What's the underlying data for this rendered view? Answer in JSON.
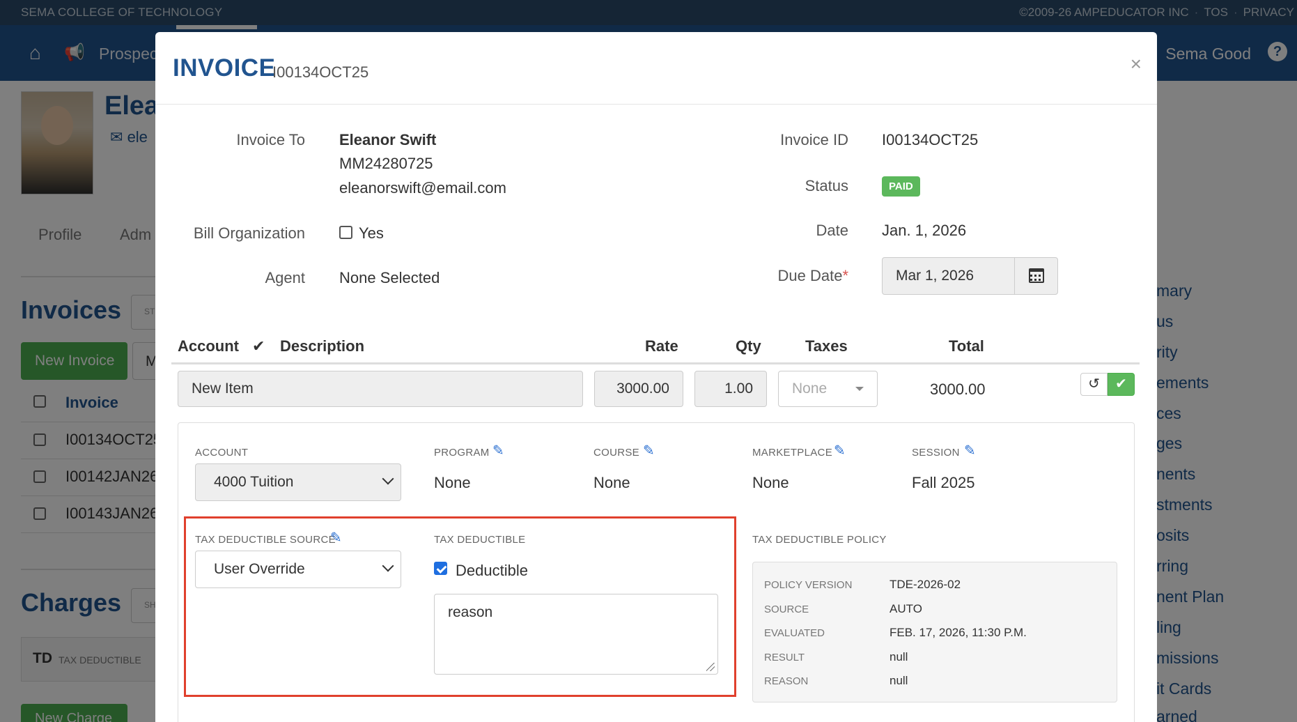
{
  "topbar": {
    "org": "SEMA COLLEGE OF TECHNOLOGY",
    "copyright": "©2009-26 AMPEDUCATOR INC",
    "sep": "·",
    "tos": "TOS",
    "privacy": "PRIVACY"
  },
  "navbar": {
    "home_icon": "⌂",
    "announce_icon": "📢",
    "nav_label": "Prospec",
    "user": "Sema Good",
    "help": "?"
  },
  "background": {
    "profile_name": "Elea",
    "profile_email": "ele",
    "email_icon": "✉",
    "tabs": [
      "Profile",
      "Adm"
    ],
    "invoices_heading": "Invoices",
    "search_placeholder": "ST",
    "new_invoice_label": "New Invoice",
    "m_button": "M",
    "invoice_column": "Invoice",
    "invoice_rows": [
      "I00134OCT25",
      "I00142JAN26",
      "I00143JAN26"
    ],
    "charges_heading": "Charges",
    "charges_search": "SH",
    "td_code": "TD",
    "td_label": "TAX DEDUCTIBLE",
    "new_charge_label": "New Charge",
    "right_nav": [
      "mary",
      "us",
      "rity",
      "ements",
      "ces",
      "ges",
      "nents",
      "stments",
      "osits",
      "rring",
      "nent Plan",
      "ling",
      "missions",
      "it Cards",
      "arned"
    ]
  },
  "modal": {
    "title": "INVOICE",
    "subtitle": "I00134OCT25",
    "close": "×",
    "invoice_to_label": "Invoice To",
    "invoice_to_name": "Eleanor Swift",
    "invoice_to_id": "MM24280725",
    "invoice_to_email": "eleanorswift@email.com",
    "bill_org_label": "Bill Organization",
    "bill_org_option": "Yes",
    "bill_org_checked": false,
    "agent_label": "Agent",
    "agent_value": "None Selected",
    "invoice_id_label": "Invoice ID",
    "invoice_id_value": "I00134OCT25",
    "status_label": "Status",
    "status_value": "PAID",
    "date_label": "Date",
    "date_value": "Jan. 1, 2026",
    "due_date_label": "Due Date",
    "required_mark": "*",
    "due_date_value": "Mar 1, 2026",
    "calendar_icon": "calendar-icon"
  },
  "line_items": {
    "headers": {
      "account": "Account",
      "check": "✔",
      "description": "Description",
      "rate": "Rate",
      "qty": "Qty",
      "taxes": "Taxes",
      "total": "Total"
    },
    "row": {
      "description": "New Item",
      "rate": "3000.00",
      "qty": "1.00",
      "taxes_placeholder": "None",
      "total": "3000.00",
      "undo_icon": "↺",
      "confirm_icon": "✔"
    }
  },
  "details": {
    "account_label": "ACCOUNT",
    "account_value": "4000 Tuition",
    "program_label": "PROGRAM",
    "program_value": "None",
    "course_label": "COURSE",
    "course_value": "None",
    "marketplace_label": "MARKETPLACE",
    "marketplace_value": "None",
    "session_label": "SESSION",
    "session_value": "Fall 2025",
    "pencil_icon": "✎",
    "tax_source_label": "TAX DEDUCTIBLE SOURCE",
    "tax_source_value": "User Override",
    "tax_deductible_label": "TAX DEDUCTIBLE",
    "deductible_option": "Deductible",
    "deductible_checked": true,
    "reason_value": "reason",
    "policy_label": "TAX DEDUCTIBLE POLICY",
    "policy": [
      {
        "key": "POLICY VERSION",
        "value": "TDE-2026-02"
      },
      {
        "key": "SOURCE",
        "value": "AUTO"
      },
      {
        "key": "EVALUATED",
        "value": "FEB. 17, 2026, 11:30 P.M."
      },
      {
        "key": "RESULT",
        "value": "null"
      },
      {
        "key": "REASON",
        "value": "null"
      }
    ]
  },
  "colors": {
    "brand_blue": "#21548f",
    "paid_green": "#5cb85c",
    "highlight_red": "#e0402d",
    "link_blue": "#2a6fd1"
  }
}
